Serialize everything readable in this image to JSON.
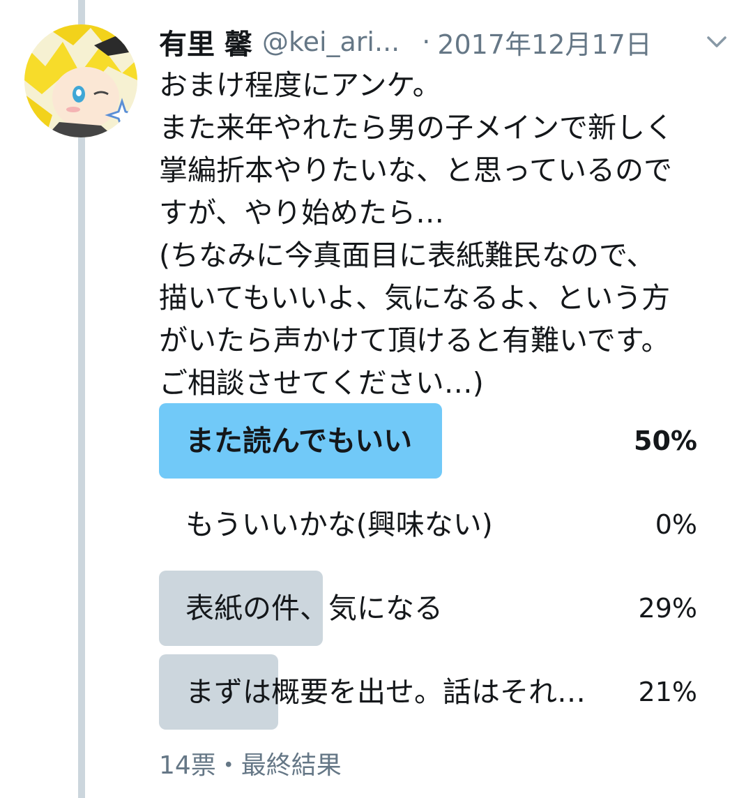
{
  "tweet": {
    "display_name": "有里 馨",
    "handle": "@kei_ari...",
    "separator": "·",
    "date": "2017年12月17日",
    "text_lines": [
      "おまけ程度にアンケ。",
      "また来年やれたら男の子メインで新しく",
      "掌編折本やりたいな、と思っているので",
      "すが、やり始めたら…",
      "(ちなみに今真面目に表紙難民なので、",
      "描いてもいいよ、気になるよ、という方",
      "がいたら声かけて頂けると有難いです。",
      "ご相談させてください…)"
    ]
  },
  "poll": {
    "options": [
      {
        "label": "また読んでもいい",
        "percent": "50%",
        "fraction": 0.5,
        "winner": true
      },
      {
        "label": "もういいかな(興味ない)",
        "percent": "0%",
        "fraction": 0.0,
        "winner": false
      },
      {
        "label": "表紙の件、気になる",
        "percent": "29%",
        "fraction": 0.29,
        "winner": false
      },
      {
        "label": "まずは概要を出せ。話はそれ…",
        "percent": "21%",
        "fraction": 0.21,
        "winner": false
      }
    ],
    "summary": "14票・最終結果"
  },
  "icons": {
    "avatar": "user-avatar",
    "caret": "chevron-down-icon"
  },
  "colors": {
    "winner_bar": "#71c9f8",
    "other_bar": "#ccd6dd",
    "secondary_text": "#657786",
    "thread_line": "#ccd6dd"
  }
}
